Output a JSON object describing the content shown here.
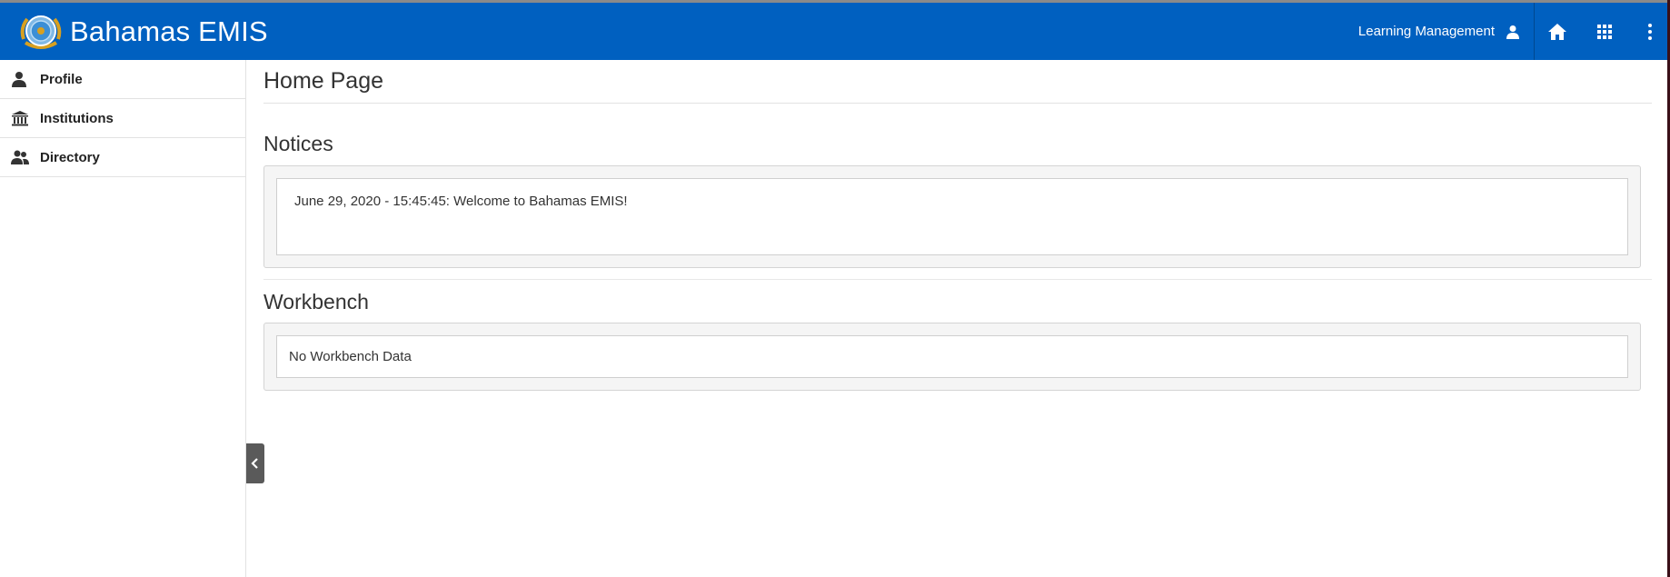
{
  "app": {
    "title": "Bahamas EMIS",
    "module": "Learning Management"
  },
  "navbar": {
    "icons": [
      "home-icon",
      "apps-grid-icon",
      "more-vertical-icon"
    ],
    "accent_color": "#0060c0"
  },
  "sidebar": {
    "items": [
      {
        "label": "Profile",
        "icon": "user-icon"
      },
      {
        "label": "Institutions",
        "icon": "institution-icon"
      },
      {
        "label": "Directory",
        "icon": "users-icon"
      }
    ]
  },
  "main": {
    "page_title": "Home Page",
    "notices": {
      "title": "Notices",
      "items": [
        "June 29, 2020 - 15:45:45: Welcome to Bahamas EMIS!"
      ]
    },
    "workbench": {
      "title": "Workbench",
      "empty_text": "No Workbench Data"
    }
  }
}
